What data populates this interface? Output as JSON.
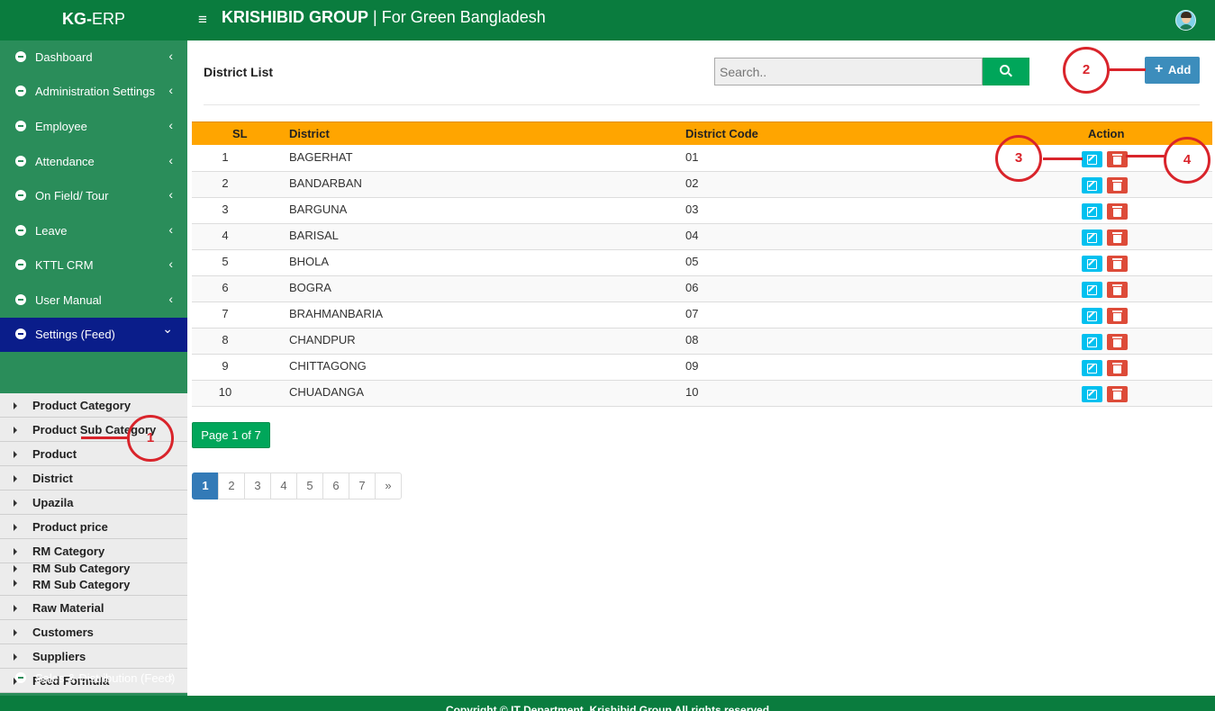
{
  "header": {
    "logo_bold": "KG-",
    "logo_rest": "ERP",
    "menu_icon": "≡",
    "title_bold": "KRISHIBID GROUP",
    "title_rest": " | For Green Bangladesh"
  },
  "sidebar": {
    "items": [
      {
        "label": "Dashboard"
      },
      {
        "label": "Administration Settings"
      },
      {
        "label": "Employee"
      },
      {
        "label": "Attendance"
      },
      {
        "label": "On Field/ Tour"
      },
      {
        "label": "Leave"
      },
      {
        "label": "KTTL CRM"
      },
      {
        "label": "User Manual"
      },
      {
        "label": "Settings (Feed)"
      }
    ],
    "sub_items": [
      "Product Category",
      "Product Sub Category",
      "Product",
      "District",
      "Upazila",
      "Product price",
      "RM Category",
      "RM Sub Category",
      "RM Sub Category",
      "Raw Material",
      "Customers",
      "Suppliers",
      "Feed Formula"
    ],
    "bottom_item": "Sales & Distribution (Feed)"
  },
  "main": {
    "title": "District List",
    "search_placeholder": "Search..",
    "add_label": "Add"
  },
  "table": {
    "headers": [
      "SL",
      "District",
      "District Code",
      "Action"
    ],
    "rows": [
      {
        "sl": "1",
        "district": "BAGERHAT",
        "code": "01"
      },
      {
        "sl": "2",
        "district": "BANDARBAN",
        "code": "02"
      },
      {
        "sl": "3",
        "district": "BARGUNA",
        "code": "03"
      },
      {
        "sl": "4",
        "district": "BARISAL",
        "code": "04"
      },
      {
        "sl": "5",
        "district": "BHOLA",
        "code": "05"
      },
      {
        "sl": "6",
        "district": "BOGRA",
        "code": "06"
      },
      {
        "sl": "7",
        "district": "BRAHMANBARIA",
        "code": "07"
      },
      {
        "sl": "8",
        "district": "CHANDPUR",
        "code": "08"
      },
      {
        "sl": "9",
        "district": "CHITTAGONG",
        "code": "09"
      },
      {
        "sl": "10",
        "district": "CHUADANGA",
        "code": "10"
      }
    ]
  },
  "pagination": {
    "badge": "Page 1 of 7",
    "pages": [
      "1",
      "2",
      "3",
      "4",
      "5",
      "6",
      "7",
      "»"
    ],
    "current": "1"
  },
  "footer": {
    "text": "Copyright © IT Department, Krishibid Group All rights reserved"
  },
  "annotations": {
    "c1": "1",
    "c2": "2",
    "c3": "3",
    "c4": "4",
    "color": "#d9242b"
  },
  "colors": {
    "header_green": "#0a7c3e",
    "sidebar_green": "#2a8d5a",
    "active_blue": "#0a1d8a",
    "table_header": "#ffa500",
    "add_button": "#3c8dbc",
    "search_button": "#00a65a"
  }
}
